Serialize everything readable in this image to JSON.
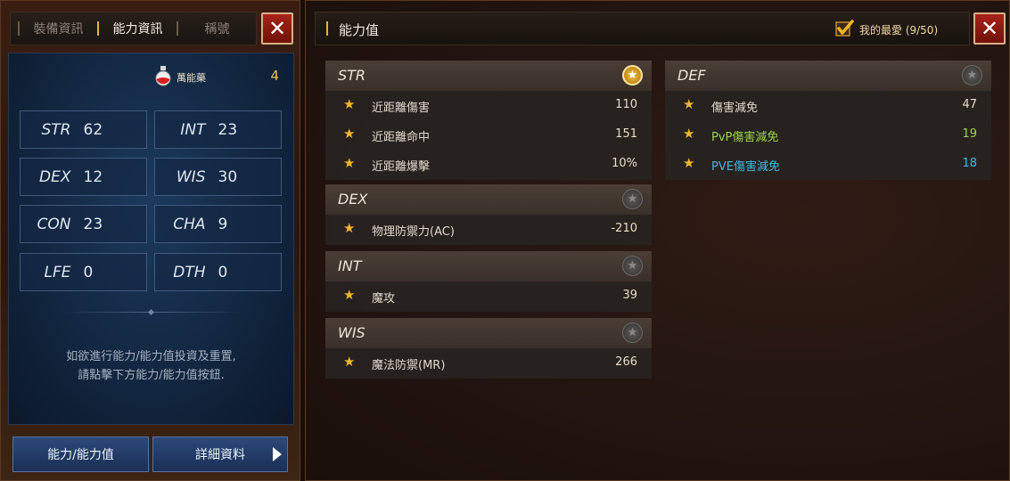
{
  "left_panel": {
    "tabs": [
      {
        "label": "裝備資訊"
      },
      {
        "label": "能力資訊"
      },
      {
        "label": "稱號"
      }
    ],
    "potion": {
      "icon": "potion-icon",
      "label": "萬能藥",
      "count": "4"
    },
    "stats": [
      {
        "name": "STR",
        "value": "62"
      },
      {
        "name": "INT",
        "value": "23"
      },
      {
        "name": "DEX",
        "value": "12"
      },
      {
        "name": "WIS",
        "value": "30"
      },
      {
        "name": "CON",
        "value": "23"
      },
      {
        "name": "CHA",
        "value": "9"
      },
      {
        "name": "LFE",
        "value": "0"
      },
      {
        "name": "DTH",
        "value": "0"
      }
    ],
    "hint_line1": "如欲進行能力/能力值投資及重置,",
    "hint_line2": "請點擊下方能力/能力值按鈕.",
    "buttons": {
      "ability": "能力/能力值",
      "detail": "詳細資料"
    }
  },
  "right_panel": {
    "title": "能力值",
    "favorites_label": "我的最愛 (9/50)",
    "sections": [
      {
        "name": "STR",
        "favorite": true,
        "rows": [
          {
            "label": "近距離傷害",
            "value": "110"
          },
          {
            "label": "近距離命中",
            "value": "151"
          },
          {
            "label": "近距離爆擊",
            "value": "10%"
          }
        ]
      },
      {
        "name": "DEX",
        "favorite": false,
        "rows": [
          {
            "label": "物理防禦力(AC)",
            "value": "-210"
          }
        ]
      },
      {
        "name": "INT",
        "favorite": false,
        "rows": [
          {
            "label": "魔攻",
            "value": "39"
          }
        ]
      },
      {
        "name": "WIS",
        "favorite": false,
        "rows": [
          {
            "label": "魔法防禦(MR)",
            "value": "266"
          }
        ]
      },
      {
        "name": "DEF",
        "favorite": false,
        "rows": [
          {
            "label": "傷害減免",
            "value": "47"
          },
          {
            "label": "PvP傷害減免",
            "value": "19"
          },
          {
            "label": "PVE傷害減免",
            "value": "18"
          }
        ]
      }
    ]
  },
  "icons": {
    "close": "close-icon",
    "star": "star-icon",
    "checkmark": "checkmark-icon",
    "arrow": "play-arrow-icon"
  },
  "colors": {
    "gold": "#f0b530",
    "pvp_green": "#9bd34b",
    "pve_cyan": "#3fb8de",
    "close_red": "#a8231a",
    "button_blue": "#2c4a7a"
  }
}
